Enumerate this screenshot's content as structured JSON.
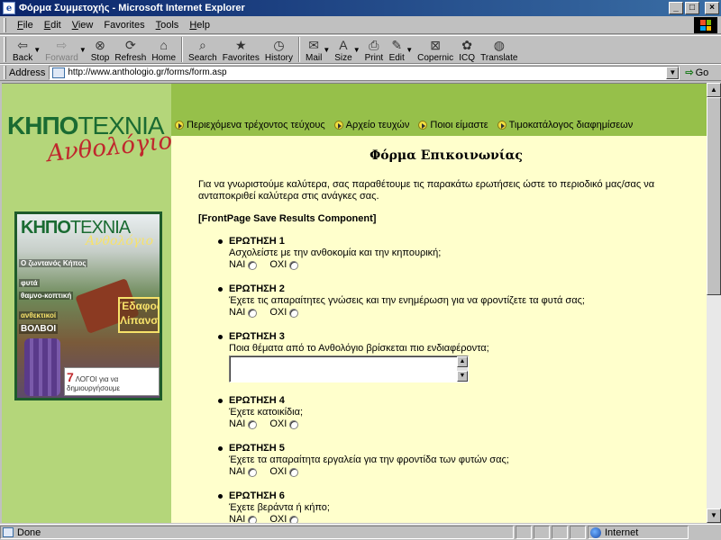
{
  "window": {
    "title": "Φόρμα Συμμετοχής - Microsoft Internet Explorer"
  },
  "menu": [
    {
      "key": "F",
      "rest": "ile"
    },
    {
      "key": "E",
      "rest": "dit"
    },
    {
      "key": "V",
      "rest": "iew"
    },
    {
      "key": "F",
      "rest": "avorites",
      "pre": "F",
      "label": "Favorites"
    },
    {
      "key": "T",
      "rest": "ools"
    },
    {
      "key": "H",
      "rest": "elp"
    }
  ],
  "toolbar": {
    "back": "Back",
    "forward": "Forward",
    "stop": "Stop",
    "refresh": "Refresh",
    "home": "Home",
    "search": "Search",
    "favorites": "Favorites",
    "history": "History",
    "mail": "Mail",
    "size": "Size",
    "print": "Print",
    "edit": "Edit",
    "copernic": "Copernic",
    "icq": "ICQ",
    "translate": "Translate"
  },
  "address": {
    "label": "Address",
    "url": "http://www.anthologio.gr/forms/form.asp",
    "go": "Go"
  },
  "logo": {
    "brand_bold": "ΚΗΠΟ",
    "brand_light": "ΤΕΧΝΙΑ",
    "script": "Ανθολόγιο"
  },
  "cover": {
    "title_bold": "ΚΗΠΟ",
    "title_light": "ΤΕΧΝΙΑ",
    "script": "Ανθολόγιο",
    "tags": [
      "Ο ζωντανός Κήπος",
      "φυτά",
      "θαμνο-κοπτική",
      "ανθεκτικοί",
      "ΒΟΛΒΟΙ"
    ],
    "badge": "Έδαφος Λίπανση",
    "bottom_num": "7",
    "bottom_text": "ΛΟΓΟΙ για να δημιουργήσουμε"
  },
  "nav": [
    "Περιεχόμενα τρέχοντος τεύχους",
    "Αρχείο τευχών",
    "Ποιοι είμαστε",
    "Τιμοκατάλογος διαφημίσεων"
  ],
  "form": {
    "title": "Φόρμα Επικοινωνίας",
    "intro": "Για να γνωριστούμε καλύτερα, σας παραθέτουμε τις παρακάτω ερωτήσεις ώστε το περιοδικό μας/σας να ανταποκριθεί καλύτερα στις ανάγκες σας.",
    "fp_note": "[FrontPage Save Results Component]",
    "yes": "ΝΑΙ",
    "no": "ΟΧΙ",
    "questions": [
      {
        "label": "ΕΡΩΤΗΣΗ 1",
        "text": "Ασχολείστε με την ανθοκομία και την κηπουρική;",
        "type": "radio"
      },
      {
        "label": "ΕΡΩΤΗΣΗ 2",
        "text": "Έχετε τις απαραίτητες γνώσεις και την ενημέρωση για να φροντίζετε τα φυτά σας;",
        "type": "radio"
      },
      {
        "label": "ΕΡΩΤΗΣΗ 3",
        "text": "Ποια θέματα από το Ανθολόγιο βρίσκεται πιο ενδιαφέροντα;",
        "type": "textarea"
      },
      {
        "label": "ΕΡΩΤΗΣΗ 4",
        "text": "Έχετε κατοικίδια;",
        "type": "radio"
      },
      {
        "label": "ΕΡΩΤΗΣΗ 5",
        "text": "Έχετε τα απαραίτητα εργαλεία για την φροντίδα των φυτών σας;",
        "type": "radio"
      },
      {
        "label": "ΕΡΩΤΗΣΗ 6",
        "text": "Έχετε βεράντα ή κήπο;",
        "type": "radio"
      }
    ]
  },
  "status": {
    "text": "Done",
    "zone": "Internet"
  },
  "colors": {
    "title_bar": "#0a246a",
    "nav_band": "#96c04a",
    "left_panel": "#b4d67a",
    "content_bg": "#ffffcc",
    "brand_green": "#1a6b32",
    "brand_red": "#c0282d"
  }
}
